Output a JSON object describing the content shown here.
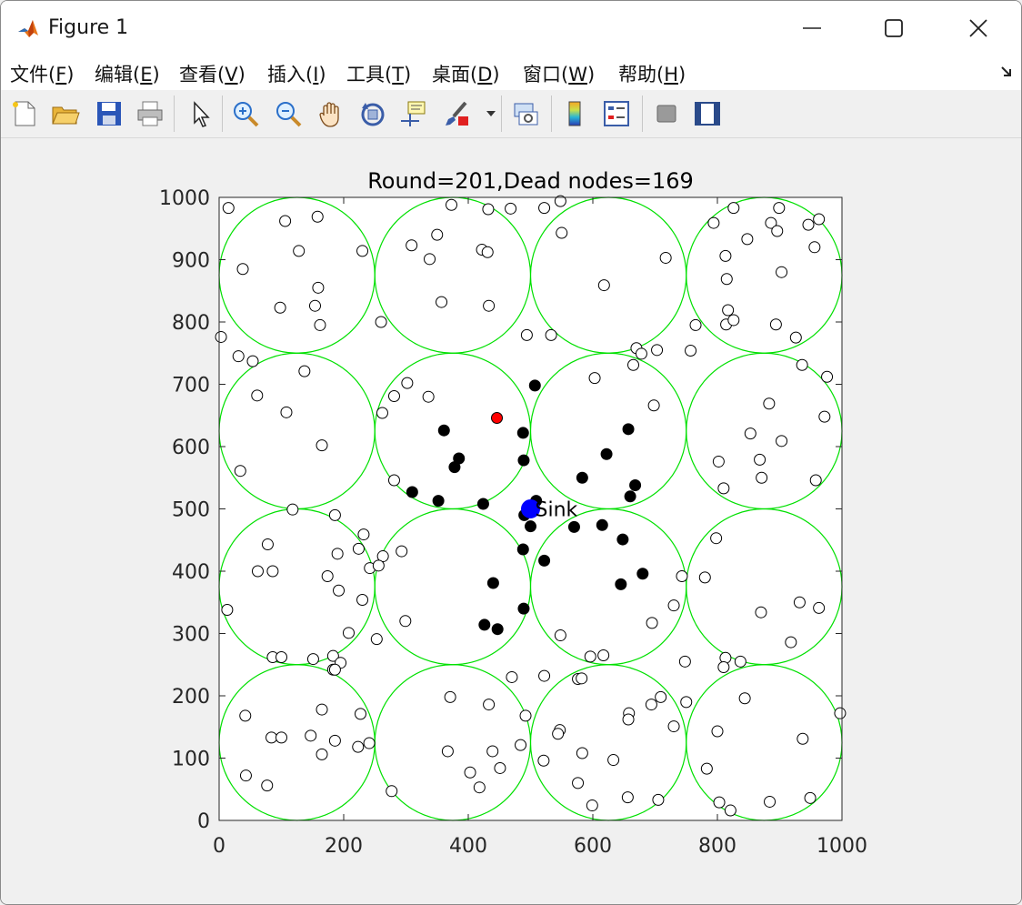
{
  "window": {
    "title": "Figure 1"
  },
  "menu": [
    {
      "pre": "文件(",
      "key": "F",
      "post": ")"
    },
    {
      "pre": "编辑(",
      "key": "E",
      "post": ")"
    },
    {
      "pre": "查看(",
      "key": "V",
      "post": ")"
    },
    {
      "pre": "插入(",
      "key": "I",
      "post": ")"
    },
    {
      "pre": "工具(",
      "key": "T",
      "post": ")"
    },
    {
      "pre": "桌面(",
      "key": "D",
      "post": ")"
    },
    {
      "pre": "窗口(",
      "key": "W",
      "post": ")"
    },
    {
      "pre": "帮助(",
      "key": "H",
      "post": ")"
    }
  ],
  "toolbar": [
    "new-figure-icon",
    "open-file-icon",
    "save-icon",
    "print-icon",
    "pointer-icon",
    "zoom-in-icon",
    "zoom-out-icon",
    "pan-hand-icon",
    "rotate-3d-icon",
    "data-cursor-icon",
    "brush-icon",
    "link-plot-icon",
    "colorbar-icon",
    "legend-icon",
    "hide-plot-tools-icon",
    "show-plot-tools-icon"
  ],
  "colors": {
    "circle": "#00e000",
    "alive": "#ffffff",
    "cluster_member": "#000000",
    "cluster_head": "#ff0000",
    "sink": "#0000ff"
  },
  "chart_data": {
    "type": "scatter",
    "title": "Round=201,Dead nodes=169",
    "xlim": [
      0,
      1000
    ],
    "ylim": [
      0,
      1000
    ],
    "xticks": [
      "0",
      "200",
      "400",
      "600",
      "800",
      "1000"
    ],
    "yticks": [
      "0",
      "100",
      "200",
      "300",
      "400",
      "500",
      "600",
      "700",
      "800",
      "900",
      "1000"
    ],
    "sink": {
      "x": 500,
      "y": 500,
      "label": "Sink"
    },
    "coverage_circles": {
      "radius": 125,
      "centers": [
        [
          125,
          875
        ],
        [
          375,
          875
        ],
        [
          625,
          875
        ],
        [
          875,
          875
        ],
        [
          125,
          625
        ],
        [
          375,
          625
        ],
        [
          625,
          625
        ],
        [
          875,
          625
        ],
        [
          125,
          375
        ],
        [
          375,
          375
        ],
        [
          625,
          375
        ],
        [
          875,
          375
        ],
        [
          125,
          125
        ],
        [
          375,
          125
        ],
        [
          625,
          125
        ],
        [
          875,
          125
        ]
      ]
    },
    "series": [
      {
        "name": "",
        "style": "alive",
        "points": [
          [
            15,
            983
          ],
          [
            106,
            962
          ],
          [
            158,
            969
          ],
          [
            38,
            885
          ],
          [
            128,
            914
          ],
          [
            230,
            914
          ],
          [
            98,
            823
          ],
          [
            154,
            826
          ],
          [
            159,
            855
          ],
          [
            162,
            795
          ],
          [
            373,
            988
          ],
          [
            468,
            982
          ],
          [
            432,
            981
          ],
          [
            522,
            983
          ],
          [
            309,
            923
          ],
          [
            350,
            940
          ],
          [
            338,
            901
          ],
          [
            422,
            916
          ],
          [
            431,
            912
          ],
          [
            357,
            832
          ],
          [
            433,
            826
          ],
          [
            260,
            800
          ],
          [
            548,
            994
          ],
          [
            550,
            943
          ],
          [
            618,
            859
          ],
          [
            717,
            903
          ],
          [
            794,
            959
          ],
          [
            826,
            983
          ],
          [
            848,
            933
          ],
          [
            886,
            959
          ],
          [
            899,
            983
          ],
          [
            896,
            946
          ],
          [
            946,
            956
          ],
          [
            963,
            965
          ],
          [
            956,
            920
          ],
          [
            813,
            906
          ],
          [
            815,
            869
          ],
          [
            903,
            880
          ],
          [
            817,
            819
          ],
          [
            814,
            796
          ],
          [
            826,
            803
          ],
          [
            894,
            796
          ],
          [
            926,
            775
          ],
          [
            3,
            776
          ],
          [
            31,
            745
          ],
          [
            54,
            737
          ],
          [
            137,
            721
          ],
          [
            61,
            682
          ],
          [
            108,
            655
          ],
          [
            165,
            602
          ],
          [
            34,
            561
          ],
          [
            302,
            702
          ],
          [
            281,
            681
          ],
          [
            336,
            680
          ],
          [
            262,
            654
          ],
          [
            281,
            546
          ],
          [
            494,
            779
          ],
          [
            533,
            779
          ],
          [
            670,
            758
          ],
          [
            678,
            749
          ],
          [
            703,
            755
          ],
          [
            757,
            754
          ],
          [
            765,
            795
          ],
          [
            665,
            731
          ],
          [
            603,
            710
          ],
          [
            698,
            666
          ],
          [
            936,
            731
          ],
          [
            976,
            712
          ],
          [
            883,
            669
          ],
          [
            972,
            648
          ],
          [
            853,
            621
          ],
          [
            903,
            609
          ],
          [
            868,
            579
          ],
          [
            802,
            576
          ],
          [
            871,
            550
          ],
          [
            810,
            533
          ],
          [
            958,
            546
          ],
          [
            118,
            499
          ],
          [
            186,
            490
          ],
          [
            232,
            459
          ],
          [
            224,
            436
          ],
          [
            190,
            428
          ],
          [
            293,
            432
          ],
          [
            263,
            424
          ],
          [
            242,
            405
          ],
          [
            256,
            409
          ],
          [
            78,
            443
          ],
          [
            62,
            400
          ],
          [
            86,
            400
          ],
          [
            174,
            392
          ],
          [
            192,
            369
          ],
          [
            230,
            354
          ],
          [
            13,
            338
          ],
          [
            299,
            320
          ],
          [
            208,
            301
          ],
          [
            253,
            291
          ],
          [
            86,
            262
          ],
          [
            100,
            262
          ],
          [
            151,
            259
          ],
          [
            183,
            264
          ],
          [
            195,
            253
          ],
          [
            183,
            242
          ],
          [
            186,
            242
          ],
          [
            743,
            392
          ],
          [
            798,
            453
          ],
          [
            780,
            390
          ],
          [
            730,
            345
          ],
          [
            695,
            317
          ],
          [
            548,
            297
          ],
          [
            596,
            263
          ],
          [
            617,
            265
          ],
          [
            748,
            255
          ],
          [
            576,
            227
          ],
          [
            582,
            228
          ],
          [
            932,
            350
          ],
          [
            963,
            341
          ],
          [
            870,
            334
          ],
          [
            918,
            286
          ],
          [
            813,
            261
          ],
          [
            810,
            246
          ],
          [
            837,
            255
          ],
          [
            42,
            168
          ],
          [
            165,
            178
          ],
          [
            227,
            171
          ],
          [
            84,
            133
          ],
          [
            100,
            133
          ],
          [
            147,
            136
          ],
          [
            186,
            128
          ],
          [
            165,
            106
          ],
          [
            223,
            118
          ],
          [
            241,
            124
          ],
          [
            43,
            72
          ],
          [
            77,
            56
          ],
          [
            371,
            198
          ],
          [
            433,
            186
          ],
          [
            367,
            111
          ],
          [
            439,
            111
          ],
          [
            403,
            77
          ],
          [
            451,
            84
          ],
          [
            418,
            53
          ],
          [
            277,
            47
          ],
          [
            470,
            230
          ],
          [
            492,
            168
          ],
          [
            484,
            121
          ],
          [
            522,
            232
          ],
          [
            694,
            186
          ],
          [
            709,
            198
          ],
          [
            658,
            172
          ],
          [
            657,
            162
          ],
          [
            547,
            145
          ],
          [
            544,
            139
          ],
          [
            583,
            108
          ],
          [
            633,
            97
          ],
          [
            730,
            151
          ],
          [
            521,
            96
          ],
          [
            576,
            60
          ],
          [
            599,
            24
          ],
          [
            656,
            37
          ],
          [
            705,
            33
          ],
          [
            750,
            190
          ],
          [
            844,
            196
          ],
          [
            800,
            143
          ],
          [
            937,
            131
          ],
          [
            783,
            83
          ],
          [
            803,
            29
          ],
          [
            821,
            16
          ],
          [
            884,
            30
          ],
          [
            949,
            36
          ],
          [
            997,
            172
          ]
        ]
      },
      {
        "name": "",
        "style": "cluster_member",
        "points": [
          [
            507,
            698
          ],
          [
            361,
            626
          ],
          [
            488,
            622
          ],
          [
            385,
            581
          ],
          [
            378,
            567
          ],
          [
            489,
            578
          ],
          [
            310,
            527
          ],
          [
            352,
            513
          ],
          [
            424,
            508
          ],
          [
            509,
            513
          ],
          [
            490,
            490
          ],
          [
            500,
            472
          ],
          [
            657,
            628
          ],
          [
            622,
            588
          ],
          [
            583,
            550
          ],
          [
            668,
            538
          ],
          [
            660,
            520
          ],
          [
            570,
            471
          ],
          [
            615,
            474
          ],
          [
            648,
            451
          ],
          [
            488,
            435
          ],
          [
            522,
            417
          ],
          [
            680,
            396
          ],
          [
            645,
            379
          ],
          [
            440,
            381
          ],
          [
            489,
            340
          ],
          [
            426,
            314
          ],
          [
            447,
            307
          ]
        ]
      },
      {
        "name": "",
        "style": "cluster_head",
        "points": [
          [
            446,
            646
          ]
        ]
      }
    ]
  }
}
